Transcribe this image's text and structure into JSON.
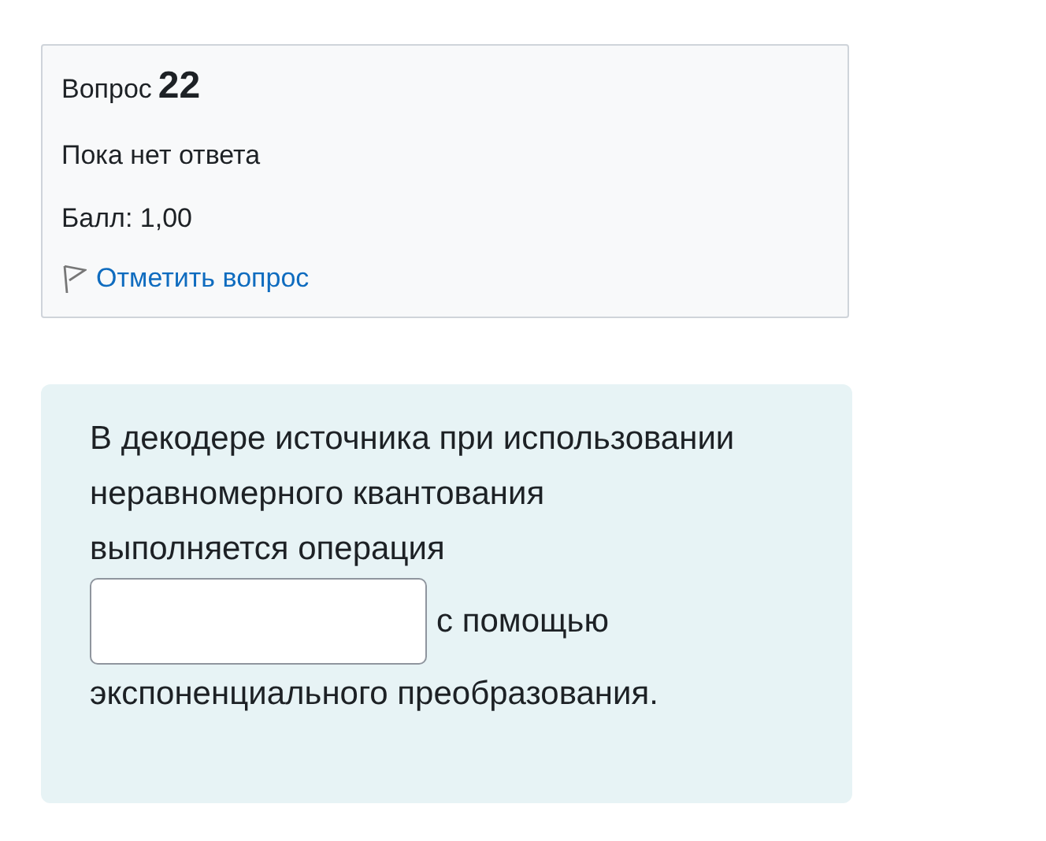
{
  "question_info": {
    "label": "Вопрос",
    "number": "22",
    "status": "Пока нет ответа",
    "grade": "Балл: 1,00",
    "flag_link": "Отметить вопрос"
  },
  "question": {
    "text_before": "В декодере источника при использовании неравномерного квантования выполняется операция",
    "text_after_field": "с помощью",
    "text_end": "экспоненциального преобразования."
  }
}
